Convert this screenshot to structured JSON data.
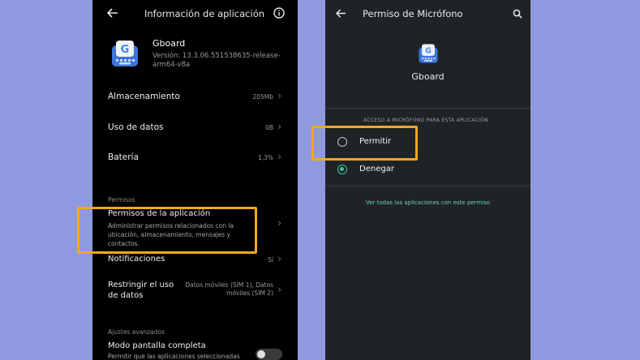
{
  "left": {
    "header": {
      "title": "Información de aplicación"
    },
    "app": {
      "name": "Gboard",
      "version": "Versión: 13.3.06.551538635-release-arm64-v8a"
    },
    "rows": {
      "storage": {
        "label": "Almacenamiento",
        "value": "205Mb"
      },
      "data_usage": {
        "label": "Uso de datos",
        "value": "0B"
      },
      "battery": {
        "label": "Batería",
        "value": "1,3%"
      }
    },
    "permissions_section": {
      "label": "Permisos"
    },
    "app_permissions": {
      "label": "Permisos de la aplicación",
      "description": "Administrar permisos relacionados con la ubicación, almacenamiento, mensajes y contactos."
    },
    "notifications": {
      "label": "Notificaciones",
      "value": "Sí"
    },
    "restrict_data": {
      "label": "Restringir el uso de datos",
      "value": "Datos móviles (SIM 1), Datos móviles (SIM 2)"
    },
    "advanced_section": {
      "label": "Ajustes avanzados"
    },
    "fullscreen": {
      "label": "Modo pantalla completa",
      "description": "Permitir que las aplicaciones seleccionadas"
    }
  },
  "right": {
    "header": {
      "title": "Permiso de Micrófono"
    },
    "app": {
      "name": "Gboard"
    },
    "section_label": "ACCESO A MICRÓFONO PARA ESTA APLICACIÓN",
    "options": [
      {
        "label": "Permitir",
        "selected": false
      },
      {
        "label": "Denegar",
        "selected": true
      }
    ],
    "link": "Ver todas las aplicaciones con este permiso"
  },
  "colors": {
    "background": "#8f99df",
    "highlight": "#f2a81f",
    "accent": "#41c3a6",
    "link": "#6fd1bc"
  },
  "icons": [
    "back-arrow-icon",
    "info-icon",
    "gboard-icon",
    "chevron-right-icon",
    "search-icon",
    "toggle-switch"
  ]
}
